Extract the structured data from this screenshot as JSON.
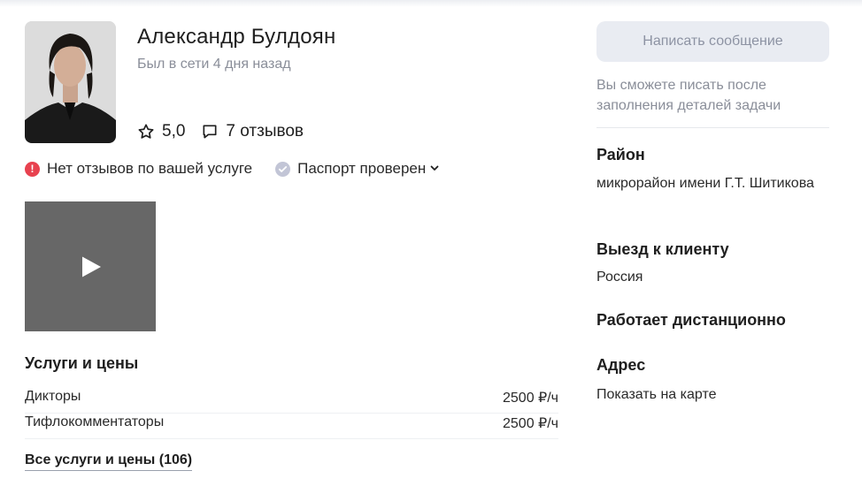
{
  "profile": {
    "name": "Александр Булдоян",
    "last_seen": "Был в сети 4 дня назад",
    "rating": "5,0",
    "reviews": "7 отзывов"
  },
  "badges": {
    "no_reviews": "Нет отзывов по вашей услуге",
    "passport": "Паспорт проверен"
  },
  "icons": {
    "star": "star-outline-icon",
    "reviews": "speech-bubble-icon",
    "warning": "exclamation-circle-icon",
    "verified": "check-badge-icon",
    "chevron": "chevron-down-icon",
    "play": "play-icon"
  },
  "colors": {
    "warning": "#e8424f",
    "verified": "#c2c5d6",
    "video_bg": "#676767",
    "button_bg": "#e9ecf2",
    "muted_text": "#8a8e99"
  },
  "services": {
    "title": "Услуги и цены",
    "items": [
      {
        "name": "Дикторы",
        "price": "2500 ₽/ч"
      },
      {
        "name": "Тифлокомментаторы",
        "price": "2500 ₽/ч"
      }
    ],
    "all_link": "Все услуги и цены (106)"
  },
  "sidebar": {
    "message_button": "Написать сообщение",
    "message_note": "Вы сможете писать после заполнения деталей задачи",
    "district_title": "Район",
    "district_value": "микрорайон имени Г.Т. Шитикова",
    "visit_title": "Выезд к клиенту",
    "visit_value": "Россия",
    "remote_title": "Работает дистанционно",
    "address_title": "Адрес",
    "address_link": "Показать на карте"
  }
}
